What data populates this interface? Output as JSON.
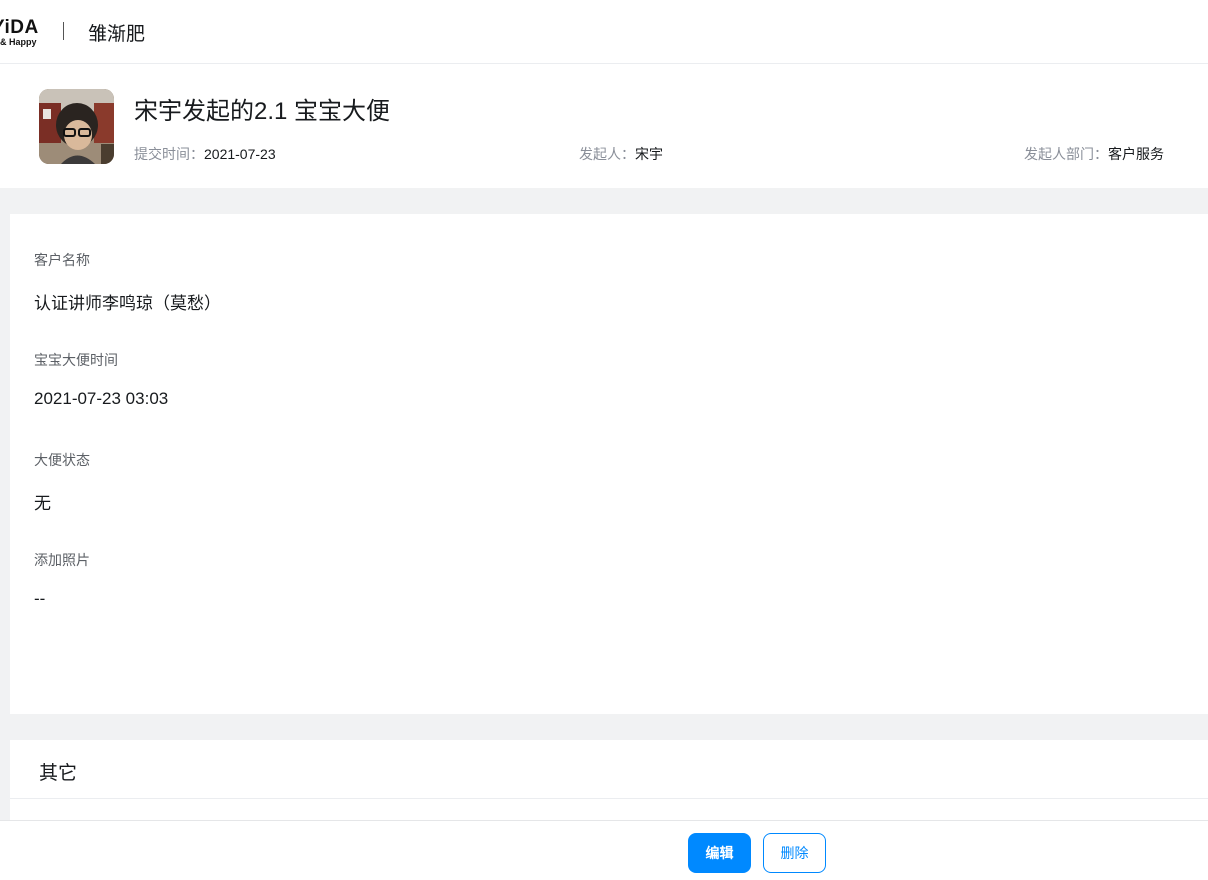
{
  "topbar": {
    "logo_main": "YiDA",
    "logo_sub": "& Happy",
    "app_name": "雏渐肥"
  },
  "header": {
    "title": "宋宇发起的2.1 宝宝大便",
    "submit_time_label": "提交时间：",
    "submit_time_value": "2021-07-23",
    "initiator_label": "发起人：",
    "initiator_value": "宋宇",
    "department_label": "发起人部门：",
    "department_value": "客户服务"
  },
  "form": {
    "fields": [
      {
        "label": "客户名称",
        "value": "认证讲师李鸣琼（莫愁）"
      },
      {
        "label": "宝宝大便时间",
        "value": "2021-07-23 03:03"
      },
      {
        "label": "大便状态",
        "value": "无"
      },
      {
        "label": "添加照片",
        "value": "--"
      }
    ]
  },
  "other": {
    "title": "其它"
  },
  "footer": {
    "edit_label": "编辑",
    "delete_label": "删除"
  },
  "colors": {
    "accent": "#0089ff",
    "page_bg": "#f1f2f3"
  }
}
